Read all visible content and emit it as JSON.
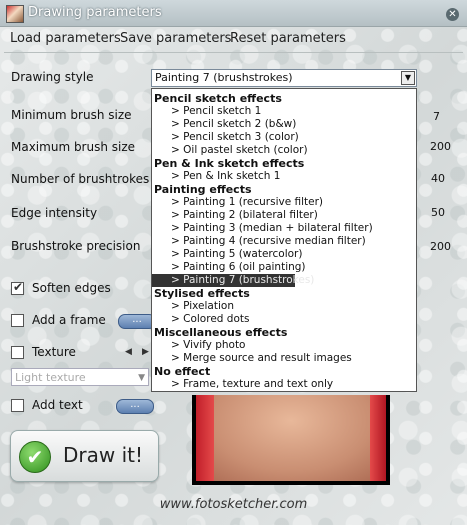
{
  "window": {
    "title": "Drawing parameters"
  },
  "menu": {
    "load": "Load parameters",
    "save": "Save parameters",
    "reset": "Reset parameters"
  },
  "labels": {
    "drawing_style": "Drawing style",
    "min_brush": "Minimum brush size",
    "max_brush": "Maximum brush size",
    "num_strokes": "Number of brushtrokes",
    "edge_intensity": "Edge intensity",
    "precision": "Brushstroke precision"
  },
  "values": {
    "min_brush": "7",
    "max_brush": "200",
    "num_strokes": "40",
    "edge_intensity": "50",
    "precision": "200"
  },
  "checkboxes": {
    "soften_edges": {
      "label": "Soften edges",
      "checked": true
    },
    "add_frame": {
      "label": "Add a frame",
      "checked": false
    },
    "texture": {
      "label": "Texture",
      "checked": false
    },
    "add_text": {
      "label": "Add text",
      "checked": false
    }
  },
  "buttons": {
    "frame_more": "...",
    "text_more": "..."
  },
  "texture_select": {
    "placeholder": "Light texture"
  },
  "drawing_style": {
    "selected": "Painting 7 (brushstrokes)",
    "groups": [
      {
        "name": "Pencil sketch effects",
        "items": [
          "> Pencil sketch 1",
          "> Pencil sketch 2 (b&w)",
          "> Pencil sketch 3 (color)",
          "> Oil pastel sketch (color)"
        ]
      },
      {
        "name": "Pen & Ink sketch effects",
        "items": [
          "> Pen & Ink sketch 1"
        ]
      },
      {
        "name": "Painting effects",
        "items": [
          "> Painting 1 (recursive filter)",
          "> Painting 2 (bilateral filter)",
          "> Painting 3 (median + bilateral filter)",
          "> Painting 4 (recursive median filter)",
          "> Painting 5 (watercolor)",
          "> Painting 6 (oil painting)",
          "> Painting 7 (brushstrokes)"
        ]
      },
      {
        "name": "Stylised effects",
        "items": [
          "> Pixelation",
          "> Colored dots"
        ]
      },
      {
        "name": "Miscellaneous effects",
        "items": [
          "> Vivify photo",
          "> Merge source and result images"
        ]
      },
      {
        "name": "No effect",
        "items": [
          "> Frame, texture and text only"
        ]
      }
    ]
  },
  "draw_button": {
    "label": "Draw it!"
  },
  "footer": {
    "url": "www.fotosketcher.com"
  },
  "colors": {
    "accent": "#5d80b0",
    "check": "#2e8e1c",
    "selected_bg": "#333333"
  }
}
